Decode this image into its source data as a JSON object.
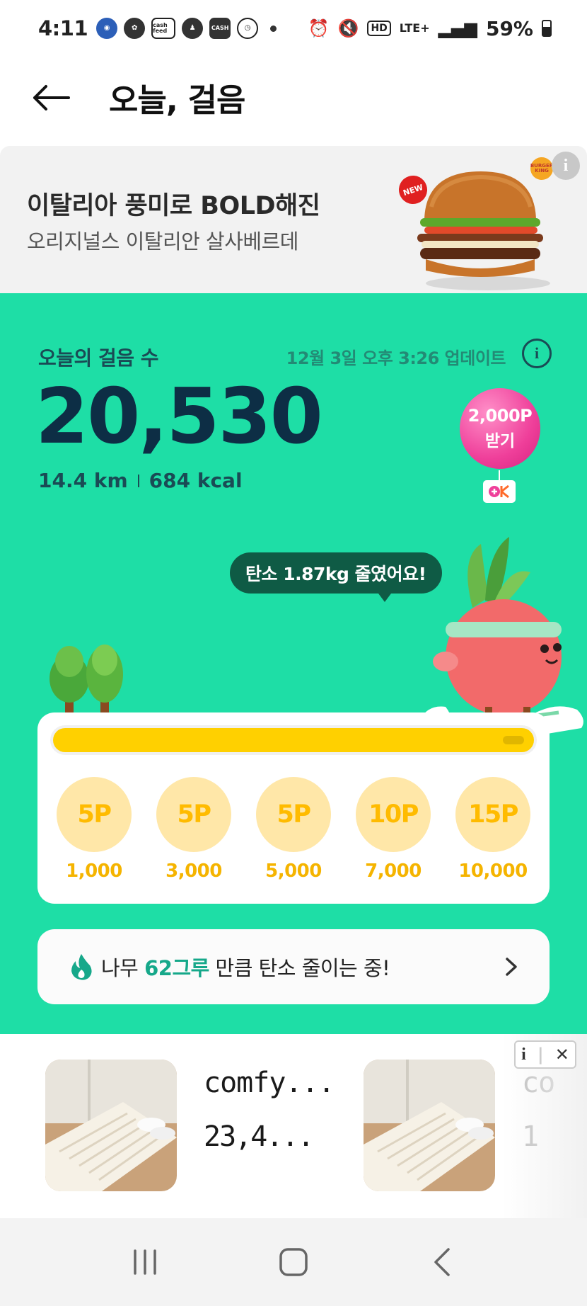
{
  "status_bar": {
    "time": "4:11",
    "apps": [
      "cash feed",
      "CASH"
    ],
    "network": "LTE+",
    "hd": "HD",
    "battery": "59%",
    "battery_level": 0.59
  },
  "header": {
    "title": "오늘, 걸음"
  },
  "ad_banner": {
    "title": "이탈리아 풍미로 BOLD해진",
    "subtitle": "오리지널스 이탈리안 살사베르데",
    "new_badge": "NEW",
    "brand": "BURGER KING",
    "info": "i"
  },
  "steps": {
    "label": "오늘의 걸음 수",
    "updated": "12월 3일 오후 3:26 업데이트",
    "count": "20,530",
    "distance": "14.4 km",
    "calories": "684 kcal"
  },
  "balloon": {
    "amount": "2,000P",
    "action": "받기"
  },
  "carbon_bubble": "탄소 1.87kg 줄였어요!",
  "progress": {
    "fill": 1.0,
    "rewards": [
      {
        "points": "5P",
        "steps": "1,000"
      },
      {
        "points": "5P",
        "steps": "3,000"
      },
      {
        "points": "5P",
        "steps": "5,000"
      },
      {
        "points": "10P",
        "steps": "7,000"
      },
      {
        "points": "15P",
        "steps": "10,000"
      }
    ]
  },
  "carbon_card": {
    "prefix": "나무 ",
    "highlight": "62그루",
    "suffix": " 만큼 탄소 줄이는 중!"
  },
  "bottom_ad": {
    "product_name": "comfy...",
    "product_price": "23,4...",
    "product_name_2": "co",
    "product_price_2": "1"
  },
  "colors": {
    "main_green": "#1edea6",
    "accent_yellow": "#ffd000",
    "balloon_pink": "#ef3f9a",
    "highlight_teal": "#16a88a"
  }
}
